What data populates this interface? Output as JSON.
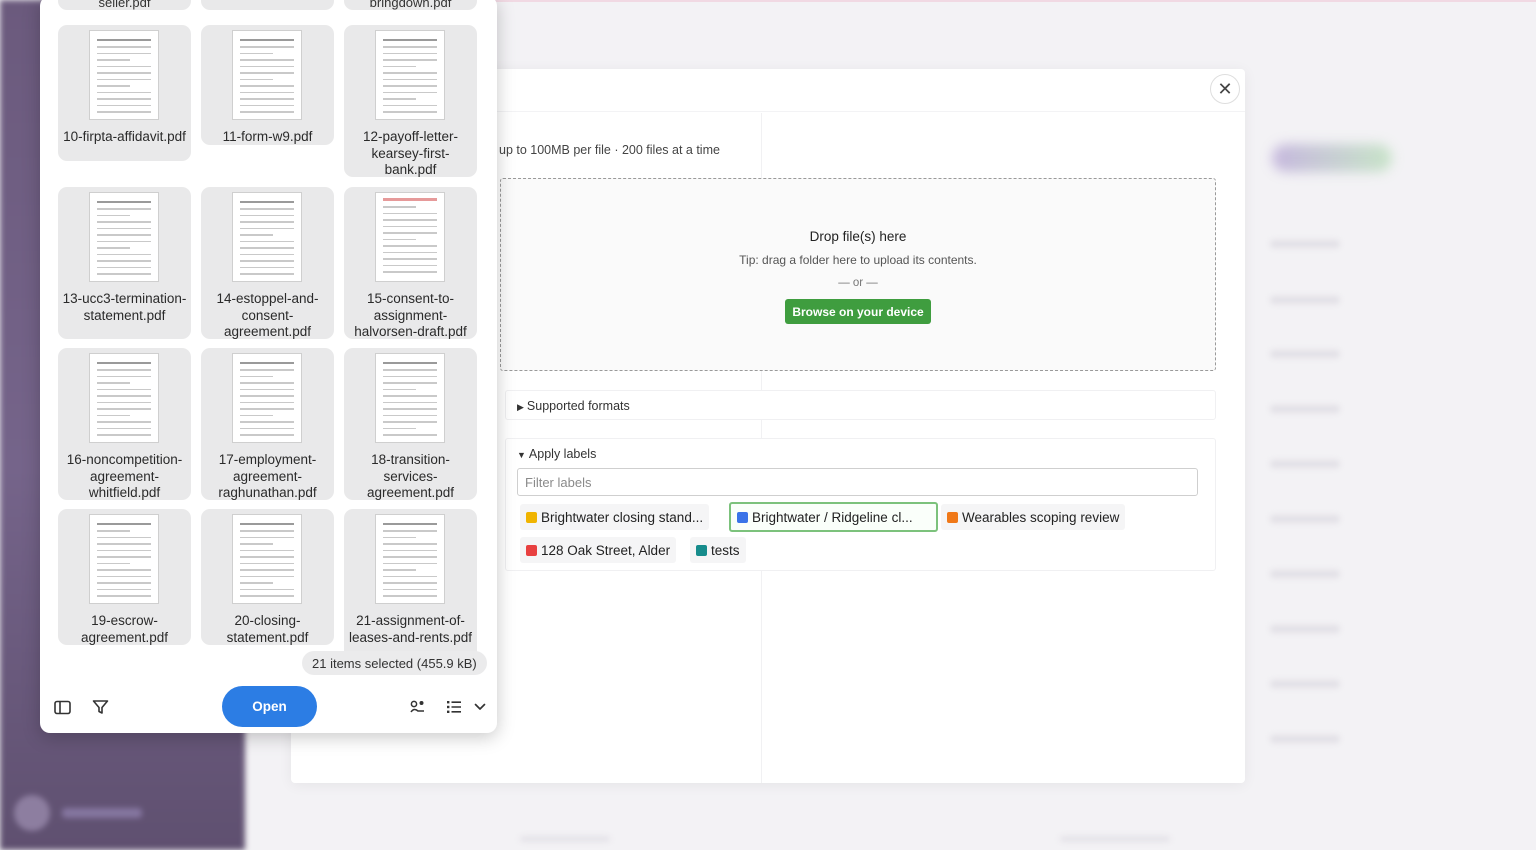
{
  "upload_modal": {
    "close_symbol": "✕",
    "limits_text": "up to 100MB per file · 200 files at a time",
    "dropzone": {
      "title": "Drop file(s) here",
      "tip": "Tip: drag a folder here to upload its contents.",
      "or": "— or —",
      "browse_label": "Browse on your device"
    },
    "supported_formats": {
      "arrow": "▶",
      "label": "Supported formats"
    },
    "apply_labels": {
      "arrow": "▼",
      "label": "Apply labels",
      "filter_placeholder": "Filter labels",
      "labels": [
        {
          "text": "Brightwater closing stand...",
          "color": "#f0b400",
          "selected": false
        },
        {
          "text": "Brightwater / Ridgeline cl...",
          "color": "#3a74e8",
          "selected": true
        },
        {
          "text": "Wearables scoping review",
          "color": "#f07818",
          "selected": false
        },
        {
          "text": "128 Oak Street, Alder",
          "color": "#e84040",
          "selected": false
        },
        {
          "text": "tests",
          "color": "#178c8c",
          "selected": false
        }
      ]
    }
  },
  "file_picker": {
    "partial_top": [
      "seller.pdf",
      "",
      "bringdown.pdf"
    ],
    "files": [
      "10-firpta-affidavit.pdf",
      "11-form-w9.pdf",
      "12-payoff-letter-kearsey-first-bank.pdf",
      "13-ucc3-termination-statement.pdf",
      "14-estoppel-and-consent-agreement.pdf",
      "15-consent-to-assignment-halvorsen-draft.pdf",
      "16-noncompetition-agreement-whitfield.pdf",
      "17-employment-agreement-raghunathan.pdf",
      "18-transition-services-agreement.pdf",
      "19-escrow-agreement.pdf",
      "20-closing-statement.pdf",
      "21-assignment-of-leases-and-rents.pdf"
    ],
    "status": "21 items selected  (455.9 kB)",
    "open_label": "Open",
    "icons": {
      "sidebar": "sidebar-toggle-icon",
      "filter": "filter-icon",
      "share": "share-icon",
      "list": "list-view-icon",
      "chevron": "chevron-down-icon"
    }
  }
}
